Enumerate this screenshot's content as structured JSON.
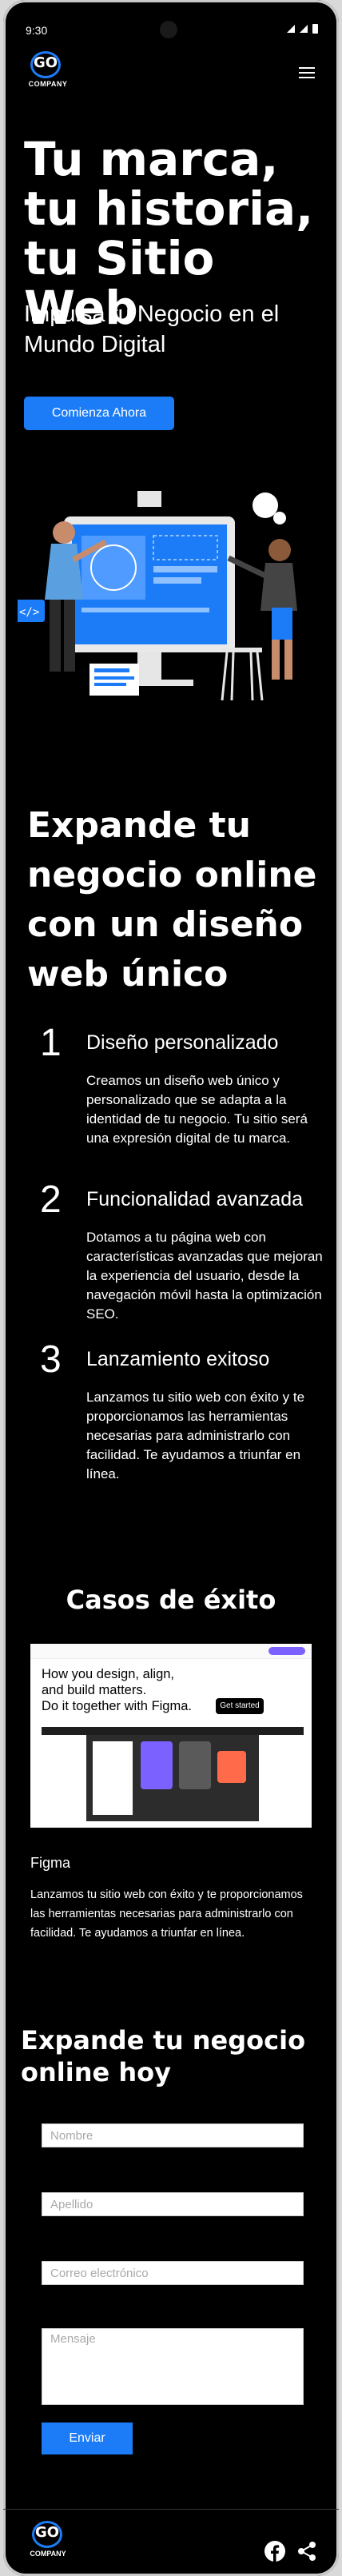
{
  "status": {
    "time": "9:30"
  },
  "brand": {
    "logo_text": "GO",
    "company": "COMPANY"
  },
  "hero": {
    "title_lines": [
      "Tu marca,",
      "tu historia,",
      "tu Sitio Web"
    ],
    "subtitle": "Impulsa tu Negocio en el Mundo Digital",
    "cta": "Comienza Ahora"
  },
  "expand": {
    "title": "Expande tu negocio online con un diseño web único",
    "features": [
      {
        "num": "1",
        "title": "Diseño personalizado",
        "desc": "Creamos un diseño web único y personalizado que se adapta a la identidad de tu negocio. Tu sitio será una expresión digital de tu marca."
      },
      {
        "num": "2",
        "title": "Funcionalidad avanzada",
        "desc": "Dotamos a tu página web con características avanzadas que mejoran la experiencia del usuario, desde la navegación móvil hasta la optimización SEO."
      },
      {
        "num": "3",
        "title": "Lanzamiento exitoso",
        "desc": "Lanzamos tu sitio web con éxito y te proporcionamos las herramientas necesarias para administrarlo con facilidad. Te ayudamos a triunfar en línea."
      }
    ]
  },
  "cases": {
    "title": "Casos de éxito",
    "screenshot": {
      "headline_1": "How you design, align,",
      "headline_2": "and build matters.",
      "headline_3": "Do it together with Figma.",
      "button": "Get started"
    },
    "name": "Figma",
    "desc": "Lanzamos tu sitio web con éxito y te proporcionamos las herramientas necesarias para administrarlo con facilidad. Te ayudamos a triunfar en línea."
  },
  "contact": {
    "title": "Expande tu negocio online hoy",
    "name_placeholder": "Nombre",
    "surname_placeholder": "Apellido",
    "email_placeholder": "Correo electrónico",
    "message_placeholder": "Mensaje",
    "submit": "Enviar"
  },
  "footer": {
    "logo_text": "GO",
    "company": "COMPANY",
    "social": [
      "facebook-icon",
      "share-icon"
    ]
  },
  "colors": {
    "accent": "#1c7cf7",
    "background": "#000000",
    "text": "#ffffff"
  }
}
